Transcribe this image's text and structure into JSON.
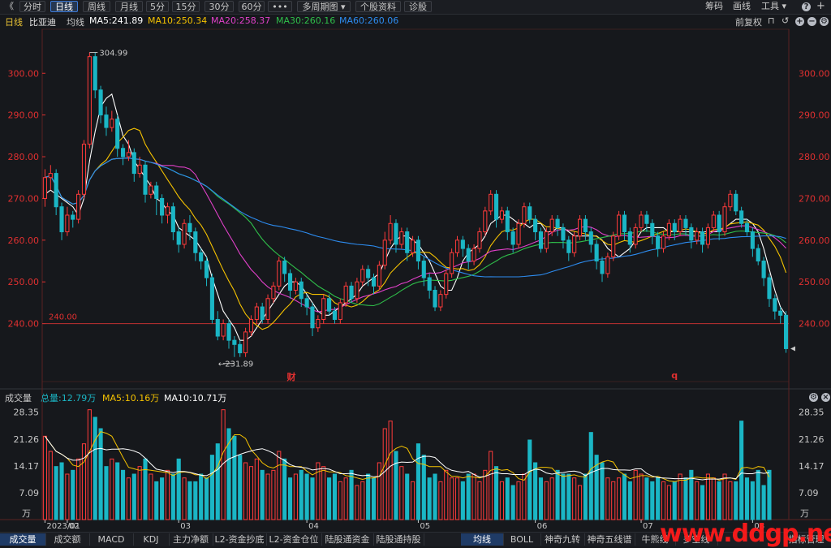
{
  "toolbar": {
    "back": "《",
    "periods": [
      "分时",
      "日线",
      "周线",
      "月线",
      "5分",
      "15分",
      "30分",
      "60分"
    ],
    "active_period": "日线",
    "more": "•••",
    "multi_period": "多周期图 ▾",
    "stock_info": "个股资料",
    "diagnose": "诊股",
    "right": [
      "筹码",
      "画线",
      "工具 ▾"
    ]
  },
  "info": {
    "period": "日线",
    "name": "比亚迪",
    "ma_label": "均线",
    "ma5": "MA5:241.89",
    "ma10": "MA10:250.34",
    "ma20": "MA20:258.37",
    "ma30": "MA30:260.16",
    "ma60": "MA60:260.06",
    "adjust": "前复权"
  },
  "colors": {
    "up": "#ff3b3b",
    "down": "#1bb6c5",
    "ma5": "#ffffff",
    "ma10": "#f5c200",
    "ma20": "#e040c8",
    "ma30": "#2fbf4a",
    "ma60": "#2d8cf0",
    "axis": "#e03030"
  },
  "volinfo": {
    "label": "成交量",
    "total": "总量:12.79万",
    "ma5": "MA5:10.16万",
    "ma10": "MA10:10.71万"
  },
  "bottom_tabs_left": [
    "成交量",
    "成交额",
    "MACD",
    "KDJ",
    "主力净额",
    "L2-资金抄底",
    "L2-资金仓位",
    "陆股通资金",
    "陆股通持股"
  ],
  "bottom_tabs_right": [
    "均线",
    "BOLL",
    "神奇九转",
    "神奇五线谱",
    "牛熊线",
    "多空线"
  ],
  "bottom_right": "指标管理",
  "watermark": "www.ddgp.net",
  "chart_data": {
    "type": "candlestick",
    "price_ticks": [
      "300.00",
      "290.00",
      "280.00",
      "270.00",
      "260.00",
      "250.00",
      "240.00"
    ],
    "ylim": [
      230,
      309
    ],
    "ref_line": "240.00",
    "high_label": "304.99",
    "low_label": "231.89",
    "event_markers": [
      "财",
      "q"
    ],
    "volume_ticks": [
      "28.35",
      "21.26",
      "14.17",
      "7.09"
    ],
    "volume_unit": "万",
    "x_labels": [
      "2023/01",
      "02",
      "03",
      "04",
      "05",
      "06",
      "07",
      "08"
    ],
    "x_label_positions": [
      0,
      4,
      24,
      47,
      67,
      88,
      107,
      127
    ],
    "candles": [
      [
        270.0,
        275.0,
        277.0,
        268.0
      ],
      [
        275.0,
        276.0,
        278.0,
        272.0
      ],
      [
        276.0,
        268.0,
        277.0,
        266.0
      ],
      [
        268.0,
        262.0,
        269.0,
        260.0
      ],
      [
        262.0,
        266.0,
        268.0,
        261.0
      ],
      [
        266.0,
        265.0,
        267.0,
        263.0
      ],
      [
        265.0,
        271.0,
        272.0,
        264.0
      ],
      [
        271.0,
        283.0,
        284.0,
        270.0
      ],
      [
        283.0,
        304.0,
        305.0,
        282.0
      ],
      [
        304.0,
        296.0,
        305.0,
        294.0
      ],
      [
        296.0,
        290.0,
        297.0,
        288.0
      ],
      [
        290.0,
        287.0,
        292.0,
        285.0
      ],
      [
        287.0,
        289.0,
        291.0,
        286.0
      ],
      [
        289.0,
        282.0,
        290.0,
        280.0
      ],
      [
        282.0,
        280.0,
        283.0,
        278.0
      ],
      [
        280.0,
        281.0,
        284.0,
        279.0
      ],
      [
        281.0,
        276.0,
        282.0,
        274.0
      ],
      [
        276.0,
        278.0,
        280.0,
        275.0
      ],
      [
        278.0,
        271.0,
        279.0,
        269.0
      ],
      [
        271.0,
        273.0,
        274.0,
        270.0
      ],
      [
        273.0,
        270.0,
        274.0,
        266.0
      ],
      [
        270.0,
        266.0,
        271.0,
        264.0
      ],
      [
        266.0,
        268.0,
        269.0,
        264.0
      ],
      [
        268.0,
        262.0,
        269.0,
        260.0
      ],
      [
        262.0,
        259.0,
        263.0,
        257.0
      ],
      [
        259.0,
        264.0,
        265.0,
        258.0
      ],
      [
        264.0,
        262.0,
        266.0,
        260.0
      ],
      [
        262.0,
        257.0,
        263.0,
        255.0
      ],
      [
        257.0,
        255.0,
        258.0,
        253.0
      ],
      [
        255.0,
        251.0,
        256.0,
        249.0
      ],
      [
        251.0,
        241.0,
        252.0,
        240.0
      ],
      [
        241.0,
        237.0,
        243.0,
        236.0
      ],
      [
        237.0,
        240.0,
        241.0,
        236.0
      ],
      [
        240.0,
        236.0,
        241.0,
        234.0
      ],
      [
        236.0,
        235.0,
        237.0,
        232.0
      ],
      [
        235.0,
        233.0,
        236.0,
        232.0
      ],
      [
        233.0,
        238.0,
        239.0,
        232.0
      ],
      [
        238.0,
        241.0,
        242.0,
        237.0
      ],
      [
        241.0,
        244.0,
        245.0,
        240.0
      ],
      [
        244.0,
        241.0,
        245.0,
        240.0
      ],
      [
        241.0,
        246.0,
        247.0,
        240.0
      ],
      [
        246.0,
        249.0,
        250.0,
        245.0
      ],
      [
        249.0,
        255.0,
        256.0,
        248.0
      ],
      [
        255.0,
        252.0,
        256.0,
        250.0
      ],
      [
        252.0,
        248.0,
        253.0,
        246.0
      ],
      [
        248.0,
        250.0,
        251.0,
        247.0
      ],
      [
        250.0,
        246.0,
        251.0,
        244.0
      ],
      [
        246.0,
        244.0,
        247.0,
        242.0
      ],
      [
        244.0,
        239.0,
        245.0,
        237.0
      ],
      [
        239.0,
        241.0,
        242.0,
        238.0
      ],
      [
        241.0,
        246.0,
        247.0,
        240.0
      ],
      [
        246.0,
        243.0,
        247.0,
        242.0
      ],
      [
        243.0,
        241.0,
        244.0,
        240.0
      ],
      [
        241.0,
        245.0,
        246.0,
        240.0
      ],
      [
        245.0,
        249.0,
        250.0,
        244.0
      ],
      [
        249.0,
        246.0,
        250.0,
        245.0
      ],
      [
        246.0,
        250.0,
        251.0,
        245.0
      ],
      [
        250.0,
        253.0,
        254.0,
        249.0
      ],
      [
        253.0,
        251.0,
        254.0,
        249.0
      ],
      [
        251.0,
        249.0,
        252.0,
        247.0
      ],
      [
        249.0,
        254.0,
        255.0,
        248.0
      ],
      [
        254.0,
        260.0,
        262.0,
        253.0
      ],
      [
        260.0,
        264.0,
        266.0,
        259.0
      ],
      [
        264.0,
        259.0,
        265.0,
        257.0
      ],
      [
        259.0,
        262.0,
        263.0,
        258.0
      ],
      [
        262.0,
        257.0,
        263.0,
        255.0
      ],
      [
        257.0,
        260.0,
        261.0,
        256.0
      ],
      [
        260.0,
        255.0,
        261.0,
        253.0
      ],
      [
        255.0,
        251.0,
        256.0,
        249.0
      ],
      [
        251.0,
        248.0,
        252.0,
        246.0
      ],
      [
        248.0,
        244.0,
        249.0,
        243.0
      ],
      [
        244.0,
        247.0,
        248.0,
        243.0
      ],
      [
        247.0,
        252.0,
        253.0,
        246.0
      ],
      [
        252.0,
        257.0,
        258.0,
        251.0
      ],
      [
        257.0,
        260.0,
        261.0,
        256.0
      ],
      [
        260.0,
        258.0,
        261.0,
        256.0
      ],
      [
        258.0,
        255.0,
        259.0,
        253.0
      ],
      [
        255.0,
        258.0,
        259.0,
        254.0
      ],
      [
        258.0,
        262.0,
        263.0,
        257.0
      ],
      [
        262.0,
        267.0,
        268.0,
        261.0
      ],
      [
        267.0,
        271.0,
        272.0,
        266.0
      ],
      [
        271.0,
        265.0,
        272.0,
        263.0
      ],
      [
        265.0,
        267.0,
        268.0,
        264.0
      ],
      [
        267.0,
        262.0,
        268.0,
        260.0
      ],
      [
        262.0,
        259.0,
        263.0,
        257.0
      ],
      [
        259.0,
        264.0,
        265.0,
        258.0
      ],
      [
        264.0,
        268.0,
        269.0,
        263.0
      ],
      [
        268.0,
        265.0,
        269.0,
        264.0
      ],
      [
        265.0,
        262.0,
        266.0,
        260.0
      ],
      [
        262.0,
        258.0,
        263.0,
        257.0
      ],
      [
        258.0,
        262.0,
        263.0,
        257.0
      ],
      [
        262.0,
        265.0,
        266.0,
        261.0
      ],
      [
        265.0,
        263.0,
        266.0,
        261.0
      ],
      [
        263.0,
        260.0,
        264.0,
        258.0
      ],
      [
        260.0,
        257.0,
        261.0,
        255.0
      ],
      [
        257.0,
        261.0,
        262.0,
        256.0
      ],
      [
        261.0,
        265.0,
        266.0,
        260.0
      ],
      [
        265.0,
        262.0,
        266.0,
        260.0
      ],
      [
        262.0,
        259.0,
        263.0,
        257.0
      ],
      [
        259.0,
        255.0,
        260.0,
        253.0
      ],
      [
        255.0,
        252.0,
        256.0,
        250.0
      ],
      [
        252.0,
        256.0,
        257.0,
        251.0
      ],
      [
        256.0,
        261.0,
        262.0,
        255.0
      ],
      [
        261.0,
        266.0,
        267.0,
        260.0
      ],
      [
        266.0,
        262.0,
        267.0,
        260.0
      ],
      [
        262.0,
        259.0,
        263.0,
        257.0
      ],
      [
        259.0,
        263.0,
        264.0,
        258.0
      ],
      [
        263.0,
        266.0,
        267.0,
        262.0
      ],
      [
        266.0,
        264.0,
        267.0,
        262.0
      ],
      [
        264.0,
        261.0,
        265.0,
        259.0
      ],
      [
        261.0,
        258.0,
        262.0,
        256.0
      ],
      [
        258.0,
        261.0,
        262.0,
        257.0
      ],
      [
        261.0,
        264.0,
        265.0,
        260.0
      ],
      [
        264.0,
        262.0,
        265.0,
        260.0
      ],
      [
        262.0,
        265.0,
        266.0,
        261.0
      ],
      [
        265.0,
        263.0,
        266.0,
        261.0
      ],
      [
        263.0,
        260.0,
        264.0,
        258.0
      ],
      [
        260.0,
        262.0,
        263.0,
        259.0
      ],
      [
        262.0,
        259.0,
        263.0,
        257.0
      ],
      [
        259.0,
        263.0,
        264.0,
        258.0
      ],
      [
        263.0,
        266.0,
        267.0,
        262.0
      ],
      [
        266.0,
        262.0,
        267.0,
        260.0
      ],
      [
        262.0,
        268.0,
        269.0,
        261.0
      ],
      [
        268.0,
        271.0,
        272.0,
        267.0
      ],
      [
        271.0,
        267.0,
        272.0,
        266.0
      ],
      [
        267.0,
        264.0,
        268.0,
        263.0
      ],
      [
        264.0,
        262.0,
        265.0,
        261.0
      ],
      [
        262.0,
        258.0,
        263.0,
        256.0
      ],
      [
        258.0,
        255.0,
        259.0,
        254.0
      ],
      [
        255.0,
        251.0,
        256.0,
        249.0
      ],
      [
        251.0,
        246.0,
        252.0,
        244.0
      ],
      [
        246.0,
        243.0,
        247.0,
        241.0
      ],
      [
        243.0,
        242.0,
        244.0,
        240.0
      ],
      [
        242.0,
        234.0,
        243.0,
        233.0
      ]
    ],
    "volumes": [
      22,
      18,
      14,
      15,
      12,
      13,
      16,
      20,
      29,
      27,
      24,
      14,
      16,
      15,
      13,
      11,
      12,
      14,
      16,
      12,
      10,
      11,
      13,
      12,
      16,
      11,
      10,
      10,
      12,
      11,
      17,
      20,
      29,
      24,
      22,
      17,
      15,
      14,
      16,
      13,
      12,
      13,
      18,
      16,
      11,
      12,
      13,
      12,
      11,
      15,
      14,
      11,
      12,
      10,
      11,
      13,
      9,
      10,
      12,
      11,
      15,
      24,
      26,
      18,
      14,
      12,
      10,
      20,
      17,
      11,
      12,
      10,
      13,
      11,
      11,
      10,
      12,
      12,
      10,
      13,
      18,
      14,
      10,
      11,
      9,
      10,
      12,
      21,
      15,
      11,
      10,
      11,
      13,
      12,
      12,
      11,
      9,
      12,
      23,
      17,
      15,
      11,
      10,
      11,
      12,
      10,
      13,
      12,
      11,
      10,
      11,
      10,
      9,
      10,
      12,
      11,
      13,
      10,
      9,
      12,
      11,
      10,
      12,
      10,
      10,
      26,
      11,
      10,
      13,
      9,
      13
    ],
    "ma5": [
      271,
      272,
      271,
      270,
      269,
      268,
      266,
      270,
      279,
      286,
      292,
      294,
      295,
      290,
      285,
      283,
      279,
      277,
      275,
      273,
      270,
      269,
      267,
      266,
      263,
      262,
      261,
      260,
      258,
      256,
      251,
      247,
      243,
      241,
      239,
      236,
      236,
      237,
      239,
      241,
      243,
      245,
      247,
      249,
      250,
      250,
      249,
      247,
      245,
      243,
      242,
      242,
      243,
      244,
      245,
      246,
      247,
      249,
      250,
      251,
      252,
      255,
      258,
      260,
      261,
      261,
      260,
      259,
      257,
      255,
      252,
      249,
      248,
      248,
      251,
      255,
      257,
      258,
      259,
      261,
      264,
      265,
      266,
      266,
      265,
      264,
      264,
      263,
      264,
      264,
      262,
      262,
      263,
      263,
      262,
      261,
      261,
      261,
      261,
      261,
      260,
      258,
      257,
      256,
      257,
      258,
      260,
      262,
      263,
      263,
      263,
      263,
      262,
      262,
      262,
      262,
      262,
      262,
      262,
      262,
      262,
      262,
      263,
      264,
      265,
      265,
      265,
      264,
      262,
      258,
      253,
      248,
      244,
      242
    ]
  }
}
